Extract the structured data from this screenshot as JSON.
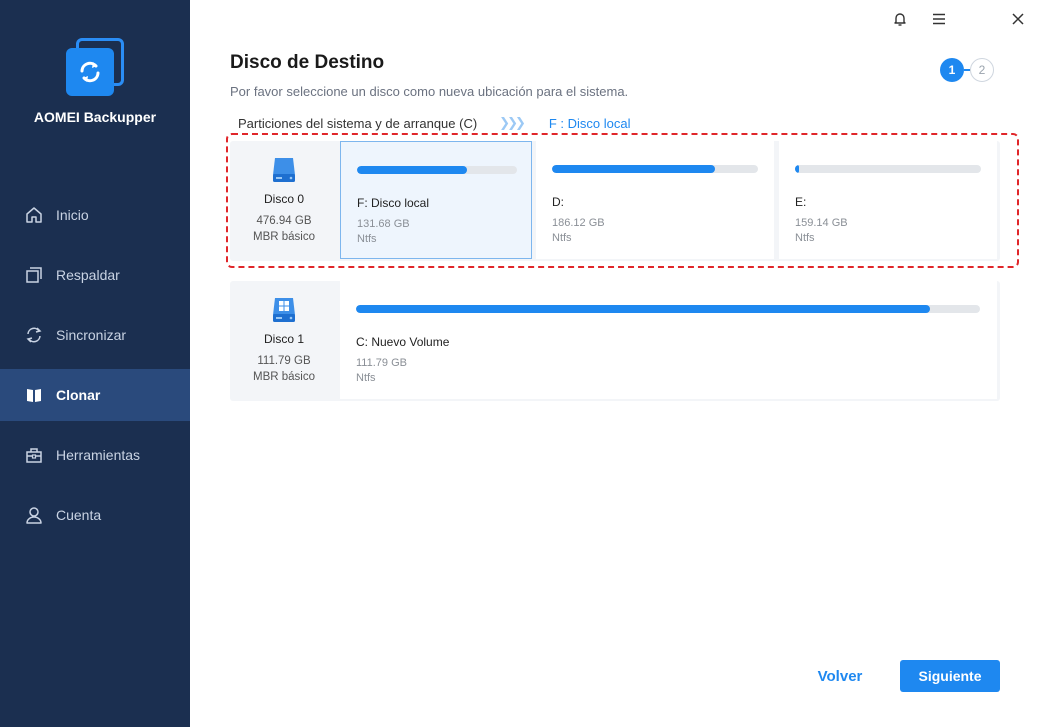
{
  "app": {
    "name": "AOMEI Backupper",
    "logo_icon": "sync-arrows-icon",
    "brand_color": "#1e88f0"
  },
  "window_controls": [
    {
      "name": "notification-bell-icon"
    },
    {
      "name": "menu-icon"
    },
    {
      "name": "close-icon"
    }
  ],
  "sidebar": {
    "items": [
      {
        "label": "Inicio",
        "icon": "home-icon",
        "active": false
      },
      {
        "label": "Respaldar",
        "icon": "backup-icon",
        "active": false
      },
      {
        "label": "Sincronizar",
        "icon": "sync-icon",
        "active": false
      },
      {
        "label": "Clonar",
        "icon": "clone-icon",
        "active": true
      },
      {
        "label": "Herramientas",
        "icon": "toolbox-icon",
        "active": false
      },
      {
        "label": "Cuenta",
        "icon": "user-icon",
        "active": false
      }
    ]
  },
  "header": {
    "title": "Disco de Destino",
    "subtitle": "Por favor seleccione un disco como nueva ubicación para el sistema.",
    "steps": [
      {
        "label": "1",
        "active": true
      },
      {
        "label": "2",
        "active": false
      }
    ]
  },
  "breadcrumb": {
    "source": "Particiones del sistema y de arranque (C)",
    "arrows": "❯❯❯",
    "destination": "F : Disco local"
  },
  "disks": [
    {
      "name": "Disco 0",
      "size": "476.94 GB",
      "type": "MBR básico",
      "icon": "hard-disk-icon",
      "partitions": [
        {
          "name": "F: Disco local",
          "size": "131.68 GB",
          "fs": "Ntfs",
          "used_fraction": 0.69,
          "selected": true
        },
        {
          "name": "D:",
          "size": "186.12 GB",
          "fs": "Ntfs",
          "used_fraction": 0.79,
          "selected": false
        },
        {
          "name": "E:",
          "size": "159.14 GB",
          "fs": "Ntfs",
          "used_fraction": 0.02,
          "selected": false
        }
      ]
    },
    {
      "name": "Disco 1",
      "size": "111.79 GB",
      "type": "MBR básico",
      "icon": "windows-disk-icon",
      "partitions": [
        {
          "name": "C: Nuevo Volume",
          "size": "111.79 GB",
          "fs": "Ntfs",
          "used_fraction": 0.92,
          "selected": false
        }
      ]
    }
  ],
  "footer": {
    "back_label": "Volver",
    "next_label": "Siguiente"
  }
}
